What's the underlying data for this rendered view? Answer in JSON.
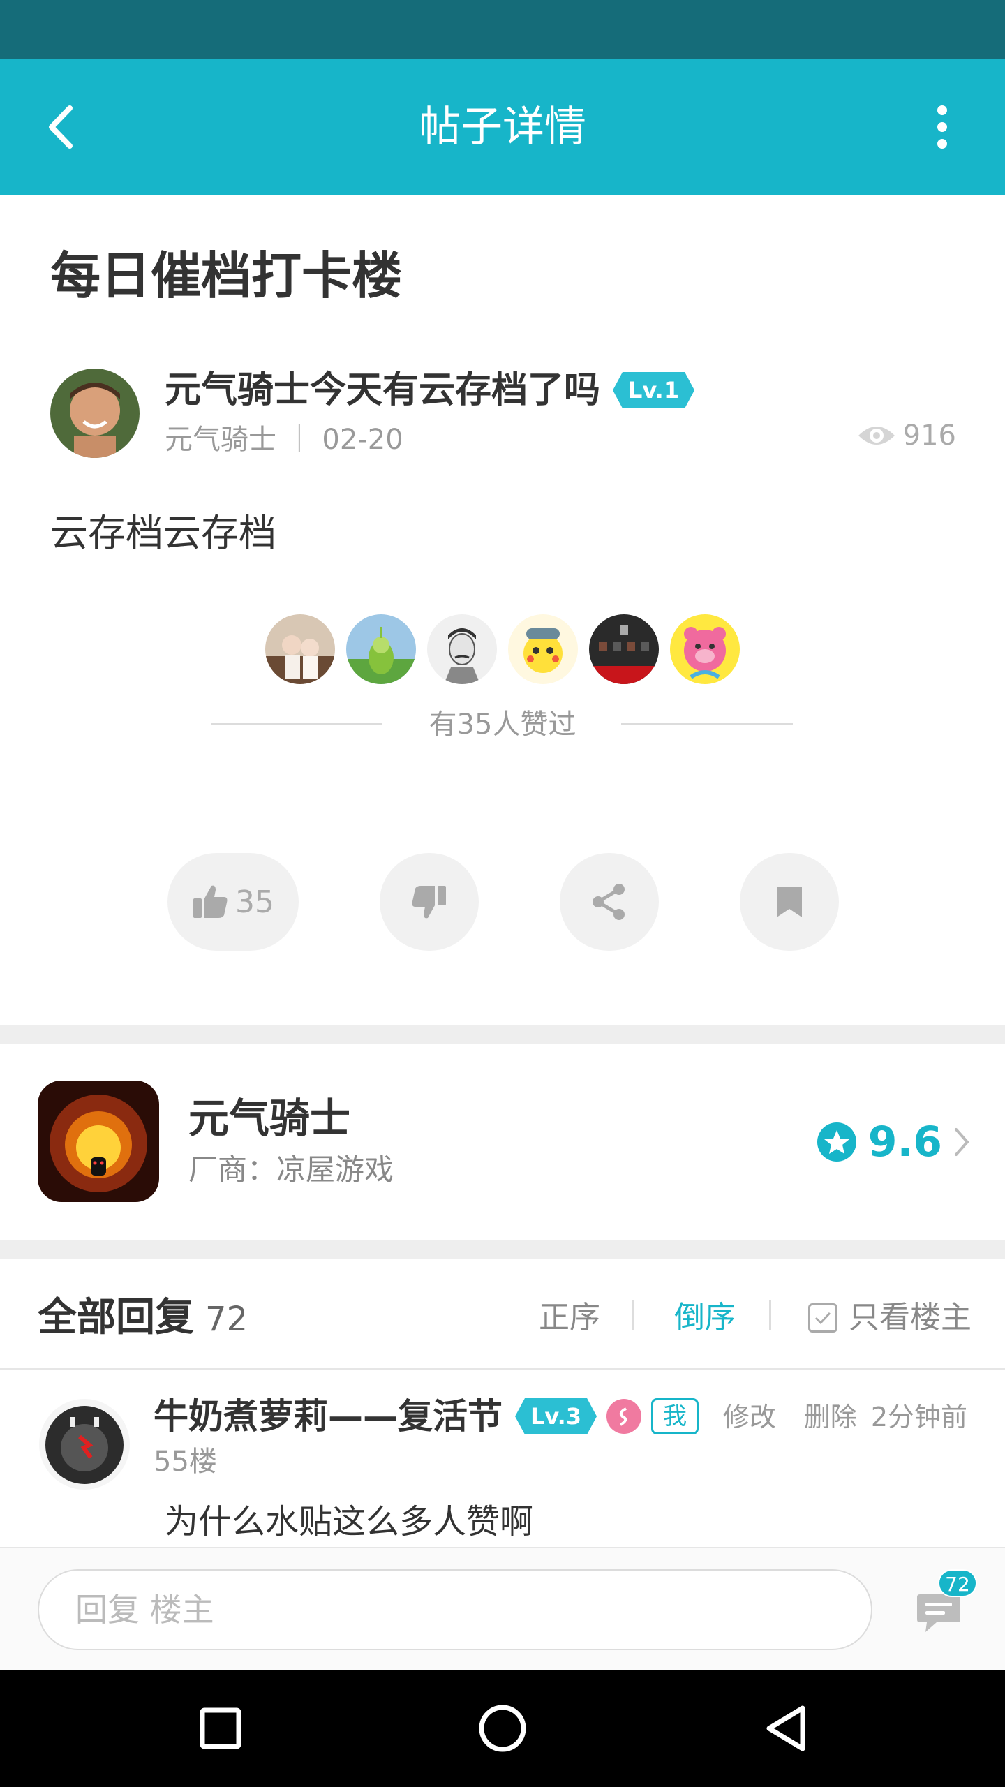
{
  "appbar": {
    "title": "帖子详情",
    "back_icon": "chevron-left-icon",
    "more_icon": "more-vertical-icon"
  },
  "post": {
    "title": "每日催档打卡楼",
    "author": {
      "name": "元气骑士今天有云存档了吗",
      "level": "Lv.1",
      "meta": "元气骑士 ｜ 02-20"
    },
    "views": "916",
    "body": "云存档云存档",
    "likers_text": "有35人赞过"
  },
  "actions": {
    "like_count": "35"
  },
  "game": {
    "name": "元气骑士",
    "vendor": "厂商：凉屋游戏",
    "rating": "9.6"
  },
  "replies": {
    "title": "全部回复",
    "count": "72",
    "sort_asc": "正序",
    "sort_desc": "倒序",
    "only_op": "只看楼主",
    "items": [
      {
        "name": "牛奶煮萝莉——复活节",
        "level": "Lv.3",
        "me": "我",
        "floor": "55楼",
        "edit": "修改",
        "delete": "删除",
        "time": "2分钟前",
        "text": "为什么水贴这么多人赞啊"
      }
    ]
  },
  "reply_bar": {
    "placeholder": "回复  楼主",
    "badge": "72"
  },
  "colors": {
    "accent": "#17b5c9",
    "statusbar": "#156c79",
    "badge": "#2bbfd3"
  }
}
